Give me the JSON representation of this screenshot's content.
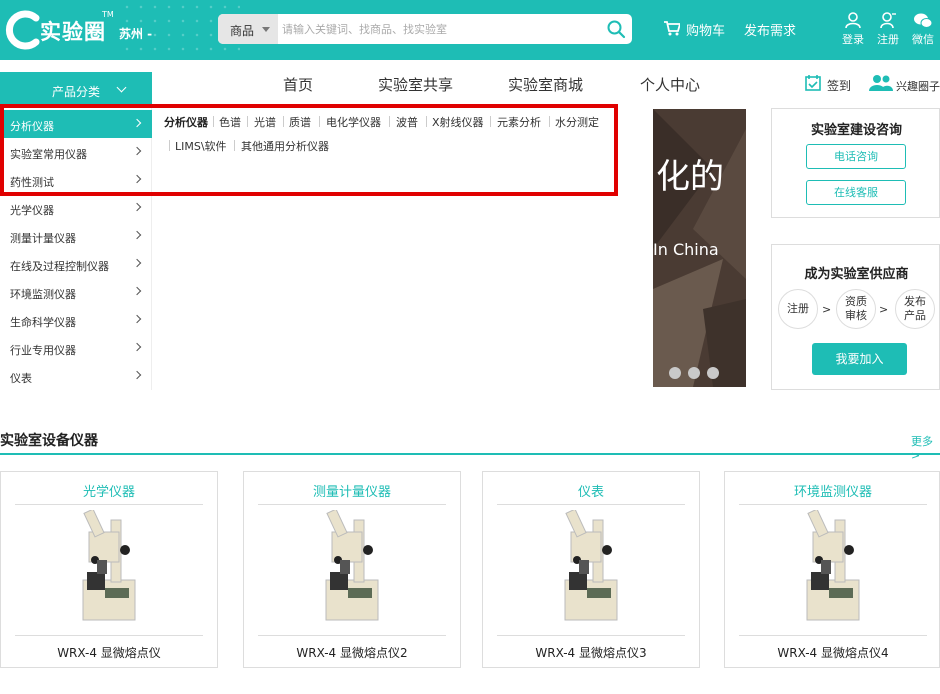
{
  "header": {
    "logo_text": "实验圈",
    "logo_tm": "TM",
    "city": "苏州 -",
    "search": {
      "category": "商品",
      "placeholder": "请输入关键词、找商品、找实验室"
    },
    "cart_label": "购物车",
    "publish_label": "发布需求",
    "login_label": "登录",
    "register_label": "注册",
    "wechat_label": "微信"
  },
  "nav": {
    "category_label": "产品分类",
    "items": [
      "首页",
      "实验室共享",
      "实验室商城",
      "个人中心"
    ],
    "signin_label": "签到",
    "interest_label": "兴趣圈子"
  },
  "sidebar": {
    "items": [
      "分析仪器",
      "实验室常用仪器",
      "药性测试",
      "光学仪器",
      "测量计量仪器",
      "在线及过程控制仪器",
      "环境监测仪器",
      "生命科学仪器",
      "行业专用仪器",
      "仪表"
    ],
    "active_index": 0
  },
  "submenu": {
    "title": "分析仪器",
    "row1": [
      "色谱",
      "光谱",
      "质谱",
      "电化学仪器",
      "波普",
      "X射线仪器",
      "元素分析",
      "水分测定"
    ],
    "row2": [
      "LIMS\\软件",
      "其他通用分析仪器"
    ]
  },
  "banner": {
    "line1": "化的",
    "line2": "In China"
  },
  "consult": {
    "title": "实验室建设咨询",
    "phone_button": "电话咨询",
    "online_button": "在线客服"
  },
  "supplier": {
    "title": "成为实验室供应商",
    "step1": "注册",
    "step2a": "资质",
    "step2b": "审核",
    "step3a": "发布",
    "step3b": "产品",
    "join_button": "我要加入"
  },
  "products": {
    "section_title": "实验室设备仪器",
    "more_label": "更多>",
    "cards": [
      {
        "category": "光学仪器",
        "name": "WRX-4 显微熔点仪"
      },
      {
        "category": "测量计量仪器",
        "name": "WRX-4 显微熔点仪2"
      },
      {
        "category": "仪表",
        "name": "WRX-4 显微熔点仪3"
      },
      {
        "category": "环境监测仪器",
        "name": "WRX-4 显微熔点仪4"
      }
    ]
  },
  "colors": {
    "accent": "#1ebdb5",
    "highlight": "#e00000",
    "banner_bg": "#4a3b33"
  }
}
